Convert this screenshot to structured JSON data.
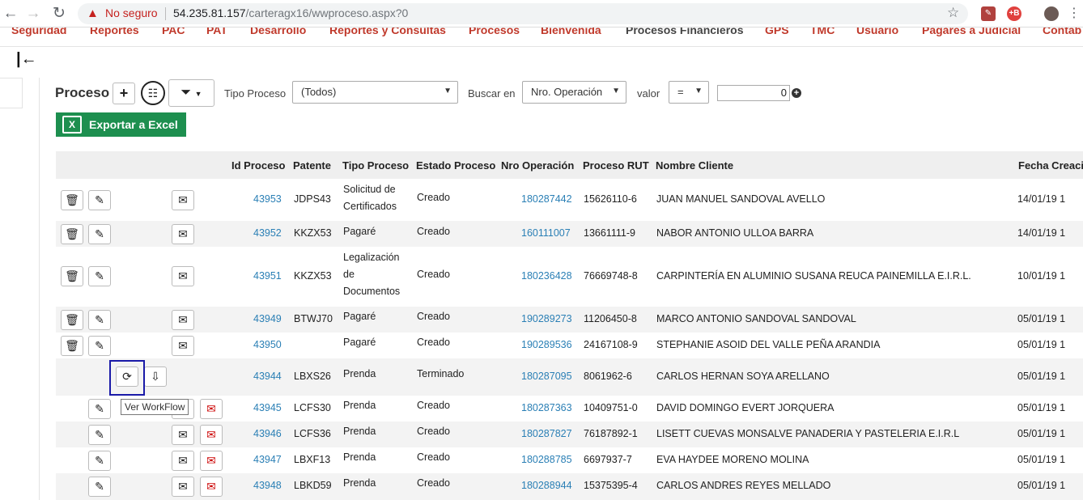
{
  "browser": {
    "insecure_label": "No seguro",
    "url_host": "54.235.81.157",
    "url_path": "/carteragx16/wwproceso.aspx?0"
  },
  "menu": [
    "Seguridad",
    "Reportes",
    "PAC",
    "PAT",
    "Desarrollo",
    "Reportes y Consultas",
    "Procesos",
    "Bienvenida",
    "Procesos Financieros",
    "GPS",
    "TMC",
    "Usuario",
    "Pagares a Judicial",
    "Contab"
  ],
  "toolbar": {
    "title": "Proceso",
    "tipo_label": "Tipo Proceso",
    "tipo_value": "(Todos)",
    "buscar_label": "Buscar en",
    "buscar_value": "Nro. Operación",
    "valor_label": "valor",
    "operator_value": "=",
    "valor_input": "0",
    "excel_label": "Exportar a Excel"
  },
  "table": {
    "columns": [
      "Id Proceso",
      "Patente",
      "Tipo Proceso",
      "Estado Proceso",
      "Nro Operación",
      "Proceso RUT",
      "Nombre Cliente",
      "Fecha Creaci"
    ],
    "rows": [
      {
        "id": "43953",
        "patente": "JDPS43",
        "tipo": "Solicitud de Certificados",
        "estado": "Creado",
        "nro": "180287442",
        "rut": "15626110-6",
        "cliente": "JUAN MANUEL SANDOVAL AVELLO",
        "fecha": "14/01/19 1"
      },
      {
        "id": "43952",
        "patente": "KKZX53",
        "tipo": "Pagaré",
        "estado": "Creado",
        "nro": "160111007",
        "rut": "13661111-9",
        "cliente": "NABOR ANTONIO ULLOA BARRA",
        "fecha": "14/01/19 1"
      },
      {
        "id": "43951",
        "patente": "KKZX53",
        "tipo": "Legalización de Documentos",
        "estado": "Creado",
        "nro": "180236428",
        "rut": "76669748-8",
        "cliente": "CARPINTERÍA EN ALUMINIO SUSANA REUCA PAINEMILLA E.I.R.L.",
        "fecha": "10/01/19 1"
      },
      {
        "id": "43949",
        "patente": "BTWJ70",
        "tipo": "Pagaré",
        "estado": "Creado",
        "nro": "190289273",
        "rut": "11206450-8",
        "cliente": "MARCO ANTONIO SANDOVAL SANDOVAL",
        "fecha": "05/01/19 1"
      },
      {
        "id": "43950",
        "patente": "",
        "tipo": "Pagaré",
        "estado": "Creado",
        "nro": "190289536",
        "rut": "24167108-9",
        "cliente": "STEPHANIE ASOID DEL VALLE PEÑA ARANDIA",
        "fecha": "05/01/19 1"
      },
      {
        "id": "43944",
        "patente": "LBXS26",
        "tipo": "Prenda",
        "estado": "Terminado",
        "nro": "180287095",
        "rut": "8061962-6",
        "cliente": "CARLOS HERNAN SOYA ARELLANO",
        "fecha": "05/01/19 1"
      },
      {
        "id": "43945",
        "patente": "LCFS30",
        "tipo": "Prenda",
        "estado": "Creado",
        "nro": "180287363",
        "rut": "10409751-0",
        "cliente": "DAVID DOMINGO EVERT JORQUERA",
        "fecha": "05/01/19 1"
      },
      {
        "id": "43946",
        "patente": "LCFS36",
        "tipo": "Prenda",
        "estado": "Creado",
        "nro": "180287827",
        "rut": "76187892-1",
        "cliente": "LISETT CUEVAS MONSALVE PANADERIA Y PASTELERIA E.I.R.L",
        "fecha": "05/01/19 1"
      },
      {
        "id": "43947",
        "patente": "LBXF13",
        "tipo": "Prenda",
        "estado": "Creado",
        "nro": "180288785",
        "rut": "6697937-7",
        "cliente": "EVA HAYDEE MORENO MOLINA",
        "fecha": "05/01/19 1"
      },
      {
        "id": "43948",
        "patente": "LBKD59",
        "tipo": "Prenda",
        "estado": "Creado",
        "nro": "180288944",
        "rut": "15375395-4",
        "cliente": "CARLOS ANDRES REYES MELLADO",
        "fecha": "05/01/19 1"
      }
    ]
  },
  "tooltip": "Ver WorkFlow"
}
